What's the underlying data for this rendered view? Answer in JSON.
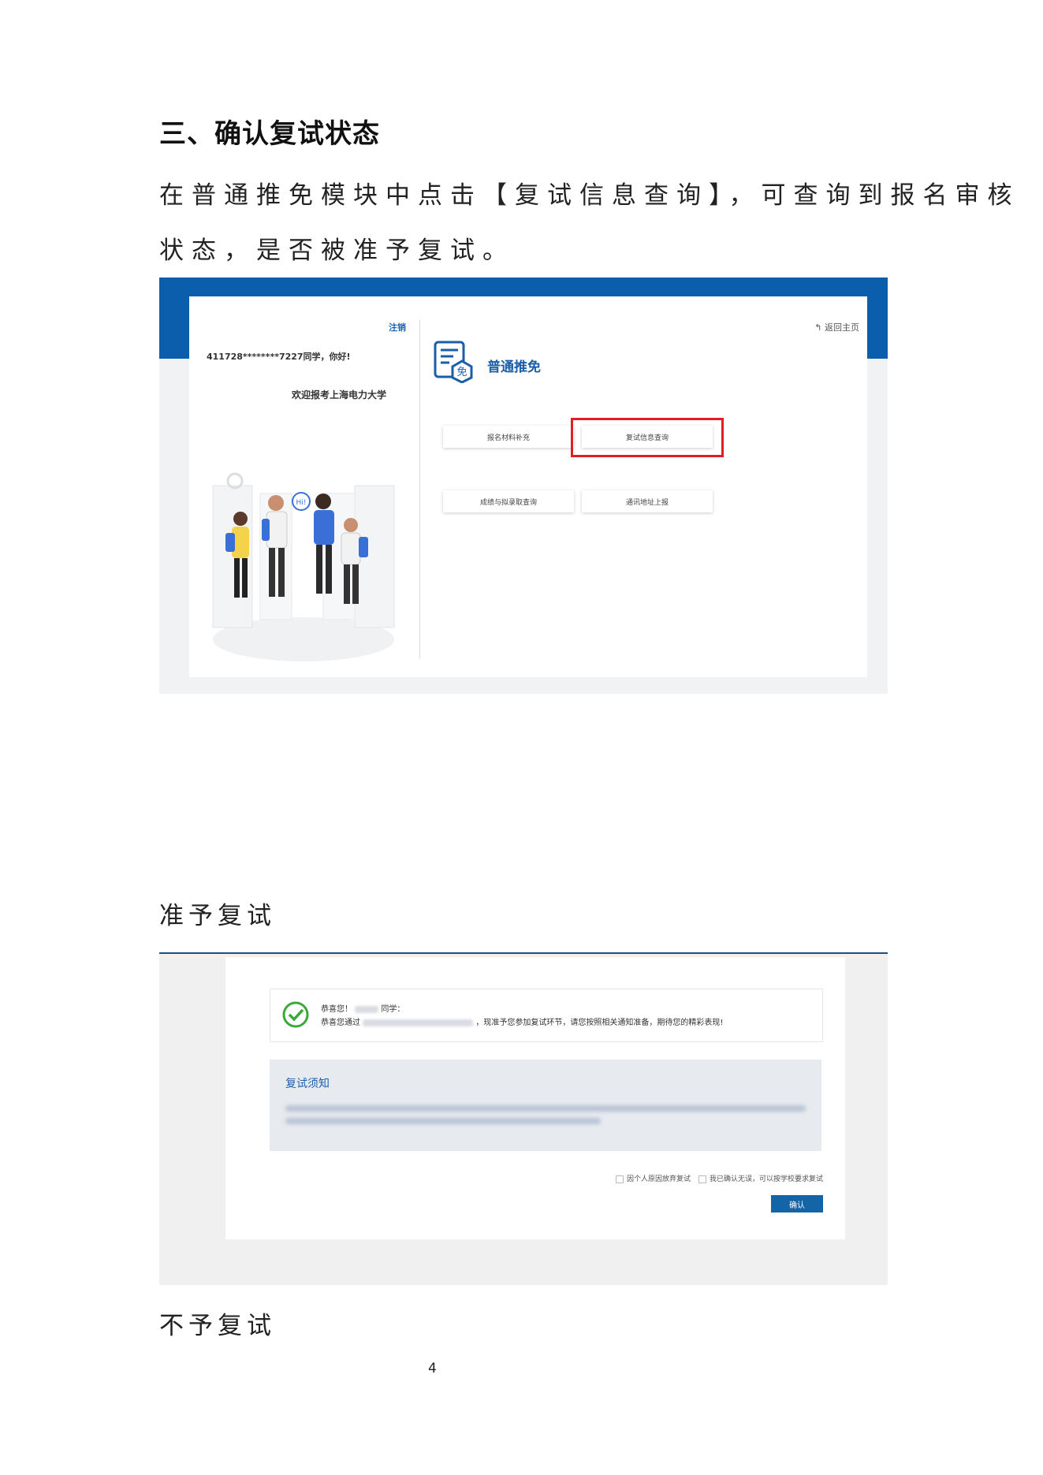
{
  "heading": "三、确认复试状态",
  "intro_line1": "在普通推免模块中点击【复试信息查询】，可查询到报名审核",
  "intro_line2": "状态，是否被准予复试。",
  "screenshot1": {
    "logout": "注销",
    "greeting": "411728********7227同学，你好!",
    "welcome": "欢迎报考上海电力大学",
    "back_home": "返回主页",
    "module_title": "普通推免",
    "logo_char": "免",
    "bubble_text": "Hi!",
    "buttons": [
      "报名材料补充",
      "复试信息查询",
      "成绩与拟录取查询",
      "通讯地址上报"
    ],
    "highlight_color": "#e02020"
  },
  "caption_approved": "准予复试",
  "screenshot2": {
    "line1_prefix": "恭喜您！",
    "line1_suffix": "同学：",
    "line2_prefix": "恭喜您通过",
    "line2_suffix": "，现准予您参加复试环节，请您按照相关通知准备，期待您的精彩表现!",
    "rules_title": "复试须知",
    "option_1": "因个人原因放弃复试",
    "option_2": "我已确认无误，可以按学校要求复试",
    "confirm_button": "确认"
  },
  "caption_rejected": "不予复试",
  "page_number": "4"
}
